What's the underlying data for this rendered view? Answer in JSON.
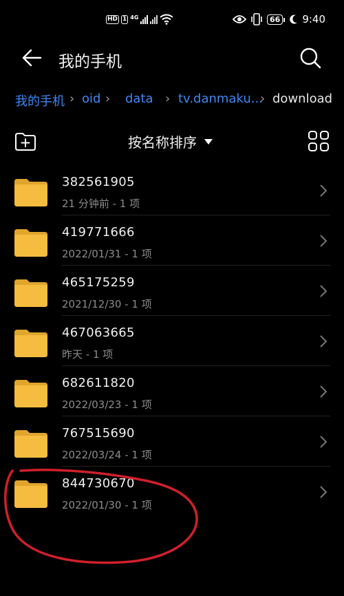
{
  "status_bar": {
    "left_badges": [
      "HD",
      "1",
      "4G"
    ],
    "battery": "66",
    "time": "9:40"
  },
  "header": {
    "title": "我的手机"
  },
  "breadcrumb": {
    "items": [
      "我的手机",
      "oid",
      "data",
      "tv.danmaku...",
      "download"
    ]
  },
  "toolbar": {
    "sort_label": "按名称排序"
  },
  "files": [
    {
      "name": "382561905",
      "meta": "21 分钟前 - 1 项"
    },
    {
      "name": "419771666",
      "meta": "2022/01/31 - 1 项"
    },
    {
      "name": "465175259",
      "meta": "2021/12/30 - 1 项"
    },
    {
      "name": "467063665",
      "meta": "昨天 - 1 项"
    },
    {
      "name": "682611820",
      "meta": "2022/03/23 - 1 项"
    },
    {
      "name": "767515690",
      "meta": "2022/03/24 - 1 项"
    },
    {
      "name": "844730670",
      "meta": "2022/01/30 - 1 项"
    }
  ],
  "colors": {
    "accent": "#3f88f5",
    "folder": "#f5bc40",
    "folder_dark": "#e0a52c",
    "annotation": "#d0202b",
    "background": "#000000"
  }
}
